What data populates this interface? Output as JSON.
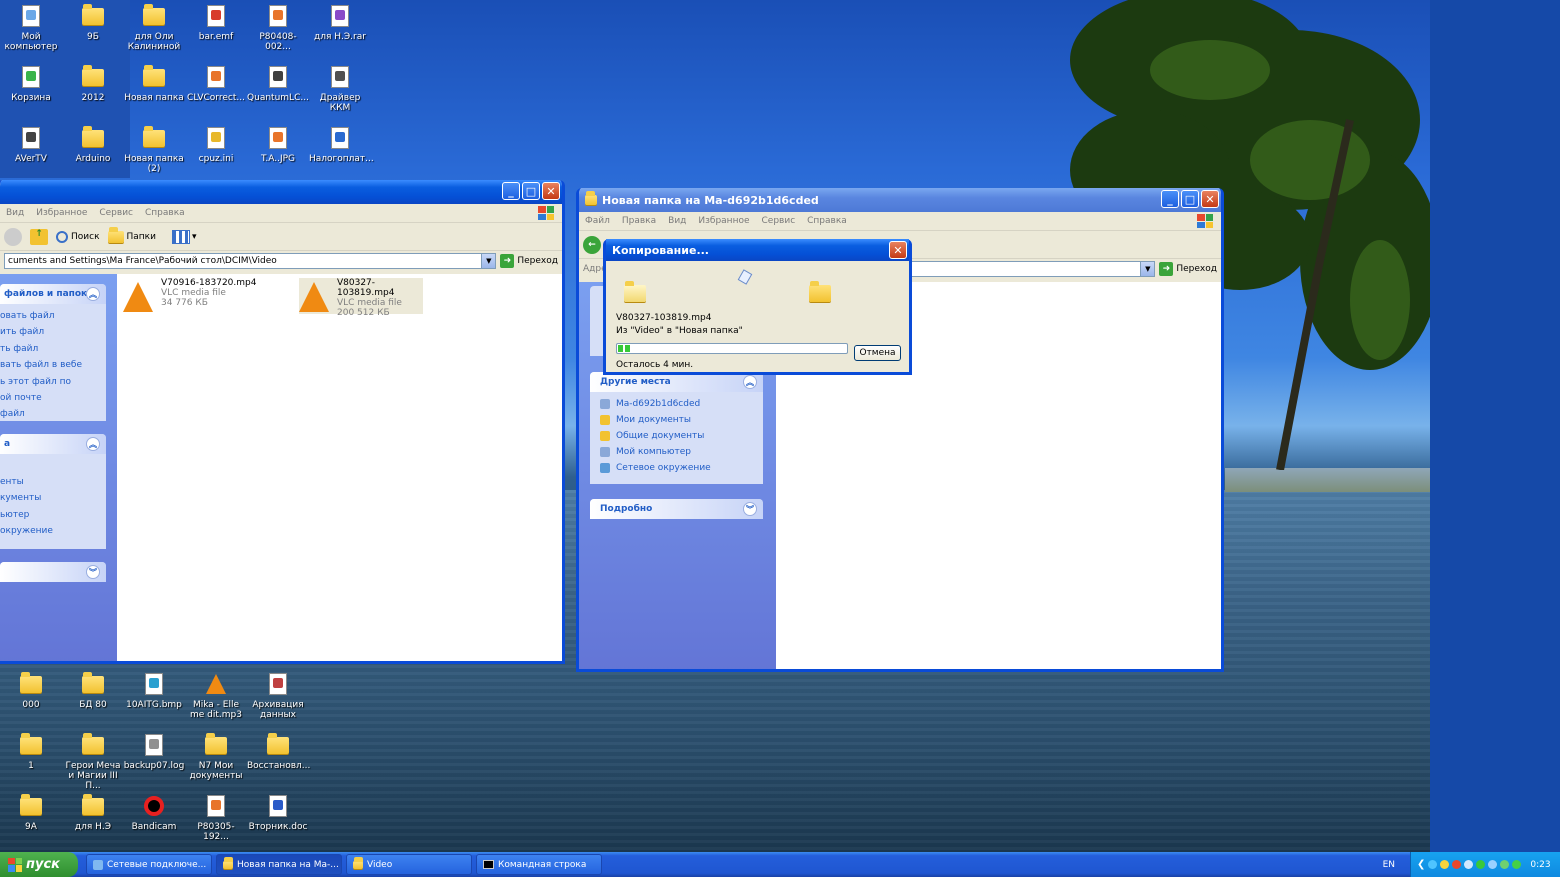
{
  "desktop_icons_top": [
    {
      "label": "Мой компьютер"
    },
    {
      "label": "9Б"
    },
    {
      "label": "для Оли Калининой"
    },
    {
      "label": "bar.emf"
    },
    {
      "label": "P80408-002..."
    },
    {
      "label": "для Н.Э.rar"
    },
    {
      "label": "Корзина"
    },
    {
      "label": "2012"
    },
    {
      "label": "Новая папка"
    },
    {
      "label": "CLVCorrect..."
    },
    {
      "label": "QuantumLC..."
    },
    {
      "label": "Драйвер ККМ"
    },
    {
      "label": "AVerTV"
    },
    {
      "label": "Arduino"
    },
    {
      "label": "Новая папка (2)"
    },
    {
      "label": "cpuz.ini"
    },
    {
      "label": "T.A..JPG"
    },
    {
      "label": "Налогоплат..."
    }
  ],
  "desktop_icons_bottom": [
    {
      "label": "000"
    },
    {
      "label": "БД 80"
    },
    {
      "label": "10AITG.bmp"
    },
    {
      "label": "Mika - Elle me dit.mp3"
    },
    {
      "label": "Архивация данных"
    },
    {
      "label": "1"
    },
    {
      "label": "Герои Меча и Магии III П..."
    },
    {
      "label": "backup07.log"
    },
    {
      "label": "N7 Мои документы"
    },
    {
      "label": "Восстановл..."
    },
    {
      "label": "9А"
    },
    {
      "label": "для Н.Э"
    },
    {
      "label": "Bandicam"
    },
    {
      "label": "P80305-192..."
    },
    {
      "label": "Вторник.doc"
    }
  ],
  "left_window": {
    "menu": [
      "Вид",
      "Избранное",
      "Сервис",
      "Справка"
    ],
    "toolbar": {
      "search": "Поиск",
      "folders": "Папки"
    },
    "address": "cuments and Settings\\Ma France\\Рабочий стол\\DCIM\\Video",
    "go_label": "Переход",
    "tasks_panel_title": "файлов и папок",
    "tasks_links": [
      "овать файл",
      "ить файл",
      "ть файл",
      "вать файл в вебе",
      "ь этот файл по",
      "ой почте",
      "файл"
    ],
    "places_panel_title": "а",
    "places_links": [
      "енты",
      "кументы",
      "ьютер",
      "окружение"
    ],
    "files": [
      {
        "name": "V70916-183720.mp4",
        "type": "VLC media file",
        "size": "34 776 КБ"
      },
      {
        "name": "V80327-103819.mp4",
        "type": "VLC media file",
        "size": "200 512 КБ"
      }
    ]
  },
  "right_window": {
    "title": "Новая папка на Ma-d692b1d6cded",
    "menu": [
      "Файл",
      "Правка",
      "Вид",
      "Избранное",
      "Сервис",
      "Справка"
    ],
    "address_label": "Адре",
    "go_label": "Переход",
    "other_places_title": "Другие места",
    "other_places": [
      "Ma-d692b1d6cded",
      "Мои документы",
      "Общие документы",
      "Мой компьютер",
      "Сетевое окружение"
    ],
    "details_title": "Подробно"
  },
  "copy_dialog": {
    "title": "Копирование...",
    "filename": "V80327-103819.mp4",
    "from_to": "Из \"Video\" в \"Новая папка\"",
    "progress": 0.06,
    "remaining": "Осталось 4 мин.",
    "cancel_label": "Отмена"
  },
  "taskbar": {
    "start_label": "пуск",
    "tasks": [
      {
        "label": "Сетевые подключе..."
      },
      {
        "label": "Новая папка на Ma-..."
      },
      {
        "label": "Video"
      },
      {
        "label": "Командная строка"
      }
    ],
    "lang": "EN",
    "clock": "0:23"
  },
  "colors": {
    "xp_blue": "#0a4bd8",
    "link": "#215dc6",
    "start_green": "#2f8f2f",
    "tray": "#0f8ae0"
  }
}
